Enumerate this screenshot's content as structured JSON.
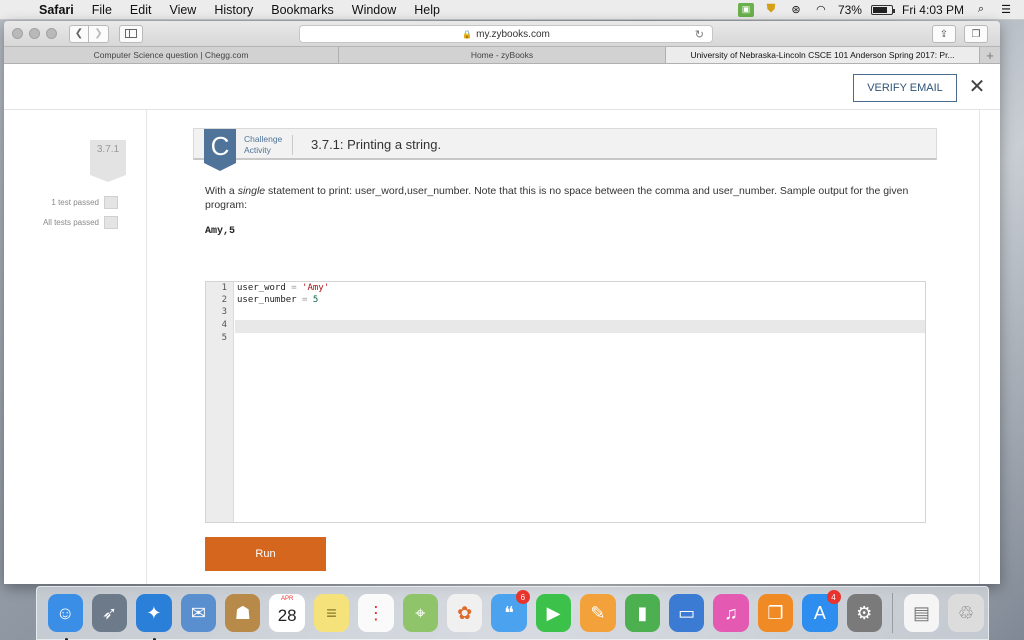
{
  "menubar": {
    "app_name": "Safari",
    "items": [
      "File",
      "Edit",
      "View",
      "History",
      "Bookmarks",
      "Window",
      "Help"
    ],
    "battery_percent": "73%",
    "clock": "Fri 4:03 PM"
  },
  "browser": {
    "url": "my.zybooks.com",
    "tabs": [
      {
        "label": "Computer Science question | Chegg.com"
      },
      {
        "label": "Home - zyBooks"
      },
      {
        "label": "University of Nebraska-Lincoln CSCE 101 Anderson Spring 2017: Pr..."
      }
    ]
  },
  "page": {
    "verify_label": "VERIFY EMAIL",
    "close_glyph": "✕",
    "section_badge": "3.7.1",
    "tests": [
      {
        "label": "1 test passed"
      },
      {
        "label": "All tests passed"
      }
    ],
    "activity": {
      "badge_letter": "C",
      "type_line1": "Challenge",
      "type_line2": "Activity",
      "title": "3.7.1: Printing a string.",
      "instr_prefix": "With a ",
      "instr_emph": "single",
      "instr_rest": " statement to print: user_word,user_number. Note that this is no space between the comma and user_number. Sample output for the given program:",
      "sample_output": "Amy,5",
      "line_numbers": [
        "1",
        "2",
        "3",
        "4",
        "5"
      ],
      "code": [
        {
          "var": "user_word",
          "op": " = ",
          "value": "'Amy'",
          "kind": "str"
        },
        {
          "var": "user_number",
          "op": " = ",
          "value": "5",
          "kind": "num"
        }
      ],
      "run_label": "Run"
    }
  },
  "dock": {
    "calendar_month": "APR",
    "calendar_day": "28",
    "messages_badge": "6",
    "appstore_badge": "4",
    "apps": [
      {
        "name": "finder",
        "color": "#3a8ee6",
        "glyph": "☺"
      },
      {
        "name": "launchpad",
        "color": "#6d7a8a",
        "glyph": "🚀"
      },
      {
        "name": "safari",
        "color": "#2a7fd9",
        "glyph": "🧭"
      },
      {
        "name": "mail",
        "color": "#5a8fcf",
        "glyph": "✉"
      },
      {
        "name": "contacts",
        "color": "#b88a4a",
        "glyph": "👤"
      },
      {
        "name": "calendar",
        "color": "#ffffff",
        "glyph": ""
      },
      {
        "name": "notes",
        "color": "#f6e27a",
        "glyph": "≡"
      },
      {
        "name": "reminders",
        "color": "#fafafa",
        "glyph": "☰"
      },
      {
        "name": "maps",
        "color": "#8fc46a",
        "glyph": "⌖"
      },
      {
        "name": "photos",
        "color": "#f0f0f0",
        "glyph": "✿"
      },
      {
        "name": "messages",
        "color": "#4ba3f0",
        "glyph": "💬"
      },
      {
        "name": "facetime",
        "color": "#3cc24b",
        "glyph": "▶"
      },
      {
        "name": "pages",
        "color": "#f3a23b",
        "glyph": "✎"
      },
      {
        "name": "numbers",
        "color": "#4caf50",
        "glyph": "▮"
      },
      {
        "name": "keynote",
        "color": "#3b7bd4",
        "glyph": "▭"
      },
      {
        "name": "itunes",
        "color": "#e45ab3",
        "glyph": "♫"
      },
      {
        "name": "ibooks",
        "color": "#f08a24",
        "glyph": "📖"
      },
      {
        "name": "app-store",
        "color": "#2d8ef0",
        "glyph": "A"
      },
      {
        "name": "system-preferences",
        "color": "#7a7a7a",
        "glyph": "⚙"
      }
    ]
  }
}
